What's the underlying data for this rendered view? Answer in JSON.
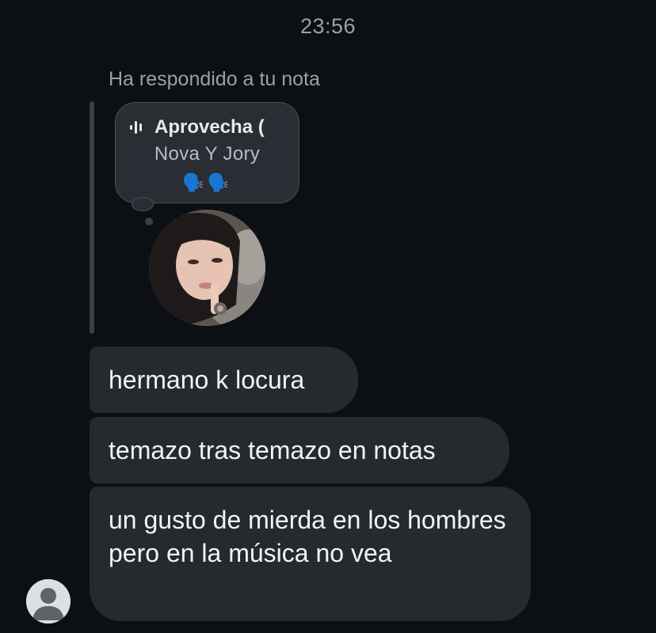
{
  "timestamp": "23:56",
  "reply_label": "Ha respondido a tu nota",
  "note": {
    "title": "Aprovecha (",
    "artist": "Nova Y Jory",
    "emoji": "🗣️🗣️",
    "icon": "audio-wave-icon"
  },
  "messages": [
    {
      "text": "hermano k locura"
    },
    {
      "text": "temazo tras temazo en notas"
    },
    {
      "text": "un gusto de mierda en los hombres pero en la música no vea"
    }
  ],
  "colors": {
    "background": "#0c0f14",
    "bubble": "#26292e",
    "secondary_text": "#9ba1a9"
  }
}
